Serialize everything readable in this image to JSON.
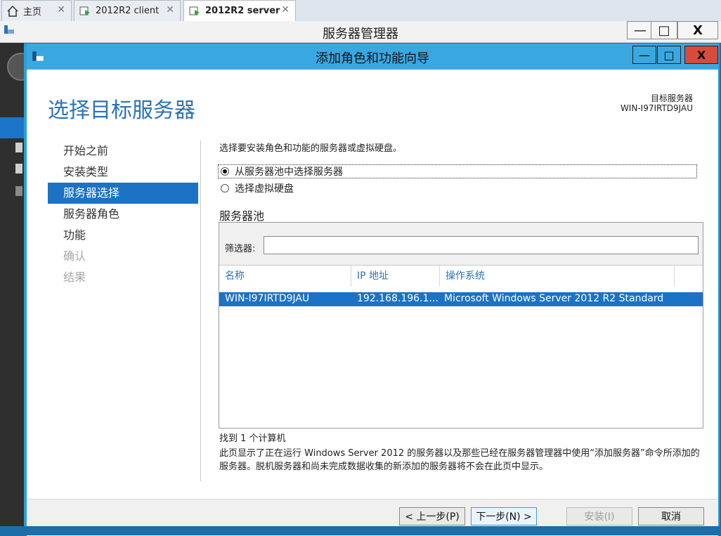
{
  "vm_tabs": [
    {
      "label": "主页",
      "icon": "home-icon",
      "active": false
    },
    {
      "label": "2012R2 client",
      "icon": "vm-icon",
      "active": false
    },
    {
      "label": "2012R2 server",
      "icon": "vm-icon",
      "active": true
    }
  ],
  "tab_close_glyph": "✕",
  "server_manager": {
    "title": "服务器管理器"
  },
  "window_controls": {
    "minimize": "—",
    "maximize": "□",
    "close": "X"
  },
  "wizard": {
    "title": "添加角色和功能向导",
    "page_title": "选择目标服务器",
    "destination_label": "目标服务器",
    "destination_value": "WIN-I97IRTD9JAU",
    "steps": [
      {
        "label": "开始之前",
        "state": "normal"
      },
      {
        "label": "安装类型",
        "state": "normal"
      },
      {
        "label": "服务器选择",
        "state": "active"
      },
      {
        "label": "服务器角色",
        "state": "normal"
      },
      {
        "label": "功能",
        "state": "normal"
      },
      {
        "label": "确认",
        "state": "disabled"
      },
      {
        "label": "结果",
        "state": "disabled"
      }
    ],
    "intro": "选择要安装角色和功能的服务器或虚拟硬盘。",
    "options": [
      {
        "label": "从服务器池中选择服务器",
        "selected": true
      },
      {
        "label": "选择虚拟硬盘",
        "selected": false
      }
    ],
    "pool": {
      "title": "服务器池",
      "filter_label": "筛选器:",
      "filter_value": "",
      "columns": [
        "名称",
        "IP 地址",
        "操作系统"
      ],
      "rows": [
        {
          "name": "WIN-I97IRTD9JAU",
          "ip": "192.168.196.1...",
          "os": "Microsoft Windows Server 2012 R2 Standard",
          "selected": true
        }
      ]
    },
    "found_text": "找到 1 个计算机",
    "description": "此页显示了正在运行 Windows Server 2012 的服务器以及那些已经在服务器管理器中使用“添加服务器”命令所添加的服务器。脱机服务器和尚未完成数据收集的新添加的服务器将不会在此页中显示。",
    "buttons": {
      "prev": "< 上一步(P)",
      "next": "下一步(N) >",
      "install": "安装(I)",
      "cancel": "取消"
    }
  },
  "colors": {
    "accent": "#1c72c4",
    "title_bar": "#3aa8e0",
    "close": "#d84a3a"
  }
}
